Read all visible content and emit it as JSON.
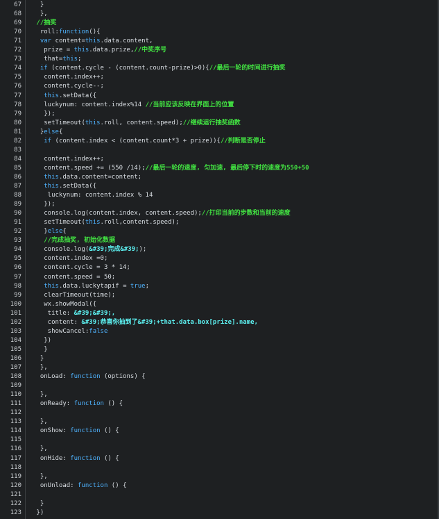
{
  "editor": {
    "lines": [
      {
        "n": "67",
        "indent": 0,
        "tokens": [
          {
            "t": "  }",
            "k": "pl"
          }
        ]
      },
      {
        "n": "68",
        "indent": 0,
        "tokens": [
          {
            "t": "  },",
            "k": "pl"
          }
        ]
      },
      {
        "n": "69",
        "indent": 0,
        "tokens": [
          {
            "t": " //抽奖",
            "k": "cm"
          }
        ]
      },
      {
        "n": "70",
        "indent": 0,
        "tokens": [
          {
            "t": "  roll:",
            "k": "pl"
          },
          {
            "t": "function",
            "k": "kw"
          },
          {
            "t": "(){",
            "k": "pl"
          }
        ]
      },
      {
        "n": "71",
        "indent": 0,
        "tokens": [
          {
            "t": "  ",
            "k": "pl"
          },
          {
            "t": "var",
            "k": "kw"
          },
          {
            "t": " content=",
            "k": "pl"
          },
          {
            "t": "this",
            "k": "kw"
          },
          {
            "t": ".data.content,",
            "k": "pl"
          }
        ]
      },
      {
        "n": "72",
        "indent": 0,
        "tokens": [
          {
            "t": "   prize = ",
            "k": "pl"
          },
          {
            "t": "this",
            "k": "kw"
          },
          {
            "t": ".data.prize,",
            "k": "pl"
          },
          {
            "t": "//中奖序号",
            "k": "cm"
          }
        ]
      },
      {
        "n": "73",
        "indent": 0,
        "tokens": [
          {
            "t": "   that=",
            "k": "pl"
          },
          {
            "t": "this",
            "k": "kw"
          },
          {
            "t": ";",
            "k": "pl"
          }
        ]
      },
      {
        "n": "74",
        "indent": 0,
        "tokens": [
          {
            "t": "  ",
            "k": "pl"
          },
          {
            "t": "if",
            "k": "kw"
          },
          {
            "t": " (content.cycle - (content.count-prize)>0){",
            "k": "pl"
          },
          {
            "t": "//最后一轮的时间进行抽奖",
            "k": "cm"
          }
        ]
      },
      {
        "n": "75",
        "indent": 0,
        "tokens": [
          {
            "t": "   content.index++;",
            "k": "pl"
          }
        ]
      },
      {
        "n": "76",
        "indent": 0,
        "tokens": [
          {
            "t": "   content.cycle--;",
            "k": "pl"
          }
        ]
      },
      {
        "n": "77",
        "indent": 0,
        "tokens": [
          {
            "t": "   ",
            "k": "pl"
          },
          {
            "t": "this",
            "k": "kw"
          },
          {
            "t": ".setData({",
            "k": "pl"
          }
        ]
      },
      {
        "n": "78",
        "indent": 0,
        "tokens": [
          {
            "t": "   luckynum: content.index%14 ",
            "k": "pl"
          },
          {
            "t": "//当前应该反映在界面上的位置",
            "k": "cm"
          }
        ]
      },
      {
        "n": "79",
        "indent": 0,
        "tokens": [
          {
            "t": "   });",
            "k": "pl"
          }
        ]
      },
      {
        "n": "80",
        "indent": 0,
        "tokens": [
          {
            "t": "   setTimeout(",
            "k": "pl"
          },
          {
            "t": "this",
            "k": "kw"
          },
          {
            "t": ".roll, content.speed);",
            "k": "pl"
          },
          {
            "t": "//继续运行抽奖函数",
            "k": "cm"
          }
        ]
      },
      {
        "n": "81",
        "indent": 0,
        "tokens": [
          {
            "t": "  }",
            "k": "pl"
          },
          {
            "t": "else",
            "k": "kw"
          },
          {
            "t": "{",
            "k": "pl"
          }
        ]
      },
      {
        "n": "82",
        "indent": 0,
        "tokens": [
          {
            "t": "   ",
            "k": "pl"
          },
          {
            "t": "if",
            "k": "kw"
          },
          {
            "t": " (content.index < (content.count*3 + prize)){",
            "k": "pl"
          },
          {
            "t": "//判断是否停止",
            "k": "cm"
          }
        ]
      },
      {
        "n": "83",
        "indent": 0,
        "tokens": []
      },
      {
        "n": "84",
        "indent": 0,
        "tokens": [
          {
            "t": "   content.index++;",
            "k": "pl"
          }
        ]
      },
      {
        "n": "85",
        "indent": 0,
        "tokens": [
          {
            "t": "   content.speed += (550 /14);",
            "k": "pl"
          },
          {
            "t": "//最后一轮的速度, 匀加速, 最后停下时的速度为550+50",
            "k": "cm"
          }
        ]
      },
      {
        "n": "86",
        "indent": 0,
        "tokens": [
          {
            "t": "   ",
            "k": "pl"
          },
          {
            "t": "this",
            "k": "kw"
          },
          {
            "t": ".data.content=content;",
            "k": "pl"
          }
        ]
      },
      {
        "n": "87",
        "indent": 0,
        "tokens": [
          {
            "t": "   ",
            "k": "pl"
          },
          {
            "t": "this",
            "k": "kw"
          },
          {
            "t": ".setData({",
            "k": "pl"
          }
        ]
      },
      {
        "n": "88",
        "indent": 0,
        "tokens": [
          {
            "t": "    luckynum: content.index % 14",
            "k": "pl"
          }
        ]
      },
      {
        "n": "89",
        "indent": 0,
        "tokens": [
          {
            "t": "   });",
            "k": "pl"
          }
        ]
      },
      {
        "n": "90",
        "indent": 0,
        "tokens": [
          {
            "t": "   console.log(content.index, content.speed);",
            "k": "pl"
          },
          {
            "t": "//打印当前的步数和当前的速度",
            "k": "cm"
          }
        ]
      },
      {
        "n": "91",
        "indent": 0,
        "tokens": [
          {
            "t": "   setTimeout(",
            "k": "pl"
          },
          {
            "t": "this",
            "k": "kw"
          },
          {
            "t": ".roll,content.speed);",
            "k": "pl"
          }
        ]
      },
      {
        "n": "92",
        "indent": 0,
        "tokens": [
          {
            "t": "   }",
            "k": "pl"
          },
          {
            "t": "else",
            "k": "kw"
          },
          {
            "t": "{",
            "k": "pl"
          }
        ]
      },
      {
        "n": "93",
        "indent": 0,
        "tokens": [
          {
            "t": "   ",
            "k": "pl"
          },
          {
            "t": "//完成抽奖, 初始化数据",
            "k": "cm"
          }
        ]
      },
      {
        "n": "94",
        "indent": 0,
        "tokens": [
          {
            "t": "   console.log(",
            "k": "pl"
          },
          {
            "t": "&#39;完成&#39;",
            "k": "str"
          },
          {
            "t": ");",
            "k": "pl"
          }
        ]
      },
      {
        "n": "95",
        "indent": 0,
        "tokens": [
          {
            "t": "   content.index =0;",
            "k": "pl"
          }
        ]
      },
      {
        "n": "96",
        "indent": 0,
        "tokens": [
          {
            "t": "   content.cycle = 3 * 14;",
            "k": "pl"
          }
        ]
      },
      {
        "n": "97",
        "indent": 0,
        "tokens": [
          {
            "t": "   content.speed = 50;",
            "k": "pl"
          }
        ]
      },
      {
        "n": "98",
        "indent": 0,
        "tokens": [
          {
            "t": "   ",
            "k": "pl"
          },
          {
            "t": "this",
            "k": "kw"
          },
          {
            "t": ".data.luckytapif = ",
            "k": "pl"
          },
          {
            "t": "true",
            "k": "kw"
          },
          {
            "t": ";",
            "k": "pl"
          }
        ]
      },
      {
        "n": "99",
        "indent": 0,
        "tokens": [
          {
            "t": "   clearTimeout(time);",
            "k": "pl"
          }
        ]
      },
      {
        "n": "100",
        "indent": 0,
        "tokens": [
          {
            "t": "   wx.showModal({",
            "k": "pl"
          }
        ]
      },
      {
        "n": "101",
        "indent": 0,
        "tokens": [
          {
            "t": "    title: ",
            "k": "pl"
          },
          {
            "t": "&#39;&#39;,",
            "k": "str"
          }
        ]
      },
      {
        "n": "102",
        "indent": 0,
        "tokens": [
          {
            "t": "    content: ",
            "k": "pl"
          },
          {
            "t": "&#39;恭喜你抽到了&#39;+that.data.box[prize].name,",
            "k": "str"
          }
        ]
      },
      {
        "n": "103",
        "indent": 0,
        "tokens": [
          {
            "t": "    showCancel:",
            "k": "pl"
          },
          {
            "t": "false",
            "k": "kw"
          }
        ]
      },
      {
        "n": "104",
        "indent": 0,
        "tokens": [
          {
            "t": "   })",
            "k": "pl"
          }
        ]
      },
      {
        "n": "105",
        "indent": 0,
        "tokens": [
          {
            "t": "   }",
            "k": "pl"
          }
        ]
      },
      {
        "n": "106",
        "indent": 0,
        "tokens": [
          {
            "t": "  }",
            "k": "pl"
          }
        ]
      },
      {
        "n": "107",
        "indent": 0,
        "tokens": [
          {
            "t": "  },",
            "k": "pl"
          }
        ]
      },
      {
        "n": "108",
        "indent": 0,
        "tokens": [
          {
            "t": "  onLoad: ",
            "k": "pl"
          },
          {
            "t": "function",
            "k": "kw"
          },
          {
            "t": " (options) {",
            "k": "pl"
          }
        ]
      },
      {
        "n": "109",
        "indent": 0,
        "tokens": []
      },
      {
        "n": "110",
        "indent": 0,
        "tokens": [
          {
            "t": "  },",
            "k": "pl"
          }
        ]
      },
      {
        "n": "111",
        "indent": 0,
        "tokens": [
          {
            "t": "  onReady: ",
            "k": "pl"
          },
          {
            "t": "function",
            "k": "kw"
          },
          {
            "t": " () {",
            "k": "pl"
          }
        ]
      },
      {
        "n": "112",
        "indent": 0,
        "tokens": []
      },
      {
        "n": "113",
        "indent": 0,
        "tokens": [
          {
            "t": "  },",
            "k": "pl"
          }
        ]
      },
      {
        "n": "114",
        "indent": 0,
        "tokens": [
          {
            "t": "  onShow: ",
            "k": "pl"
          },
          {
            "t": "function",
            "k": "kw"
          },
          {
            "t": " () {",
            "k": "pl"
          }
        ]
      },
      {
        "n": "115",
        "indent": 0,
        "tokens": []
      },
      {
        "n": "116",
        "indent": 0,
        "tokens": [
          {
            "t": "  },",
            "k": "pl"
          }
        ]
      },
      {
        "n": "117",
        "indent": 0,
        "tokens": [
          {
            "t": "  onHide: ",
            "k": "pl"
          },
          {
            "t": "function",
            "k": "kw"
          },
          {
            "t": " () {",
            "k": "pl"
          }
        ]
      },
      {
        "n": "118",
        "indent": 0,
        "tokens": []
      },
      {
        "n": "119",
        "indent": 0,
        "tokens": [
          {
            "t": "  },",
            "k": "pl"
          }
        ]
      },
      {
        "n": "120",
        "indent": 0,
        "tokens": [
          {
            "t": "  onUnload: ",
            "k": "pl"
          },
          {
            "t": "function",
            "k": "kw"
          },
          {
            "t": " () {",
            "k": "pl"
          }
        ]
      },
      {
        "n": "121",
        "indent": 0,
        "tokens": []
      },
      {
        "n": "122",
        "indent": 0,
        "tokens": [
          {
            "t": "  }",
            "k": "pl"
          }
        ]
      },
      {
        "n": "123",
        "indent": 0,
        "tokens": [
          {
            "t": " })",
            "k": "pl"
          }
        ]
      }
    ]
  },
  "colors": {
    "background": "#1e2022",
    "line_number": "#c9cdd1",
    "plain": "#d8dde2",
    "keyword": "#4fb3ff",
    "comment": "#42e342",
    "string": "#5df2f2"
  }
}
